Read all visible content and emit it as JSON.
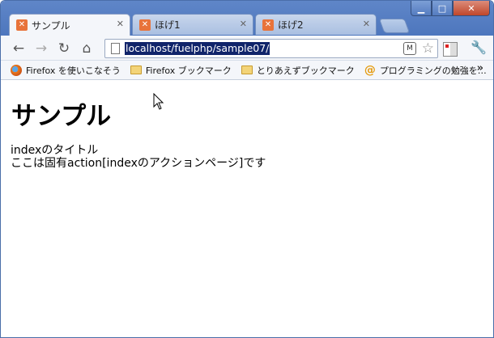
{
  "window": {
    "controls": {
      "minimize": "▁",
      "maximize": "□",
      "close": "✕"
    }
  },
  "tabs": [
    {
      "label": "サンプル",
      "icon": "xampp-icon",
      "active": true
    },
    {
      "label": "ほげ1",
      "icon": "xampp-icon",
      "active": false
    },
    {
      "label": "ほげ2",
      "icon": "xampp-icon",
      "active": false
    }
  ],
  "toolbar": {
    "url": "localhost/fuelphp/sample07/"
  },
  "bookmarks": [
    {
      "label": "Firefox を使いこなそう",
      "icon": "firefox-icon"
    },
    {
      "label": "Firefox ブックマーク",
      "icon": "folder-icon"
    },
    {
      "label": "とりあえずブックマーク",
      "icon": "folder-icon"
    },
    {
      "label": "プログラミングの勉強を…",
      "icon": "at-icon"
    }
  ],
  "page": {
    "heading": "サンプル",
    "lines": [
      "indexのタイトル",
      "ここは固有action[indexのアクションページ]です"
    ]
  }
}
